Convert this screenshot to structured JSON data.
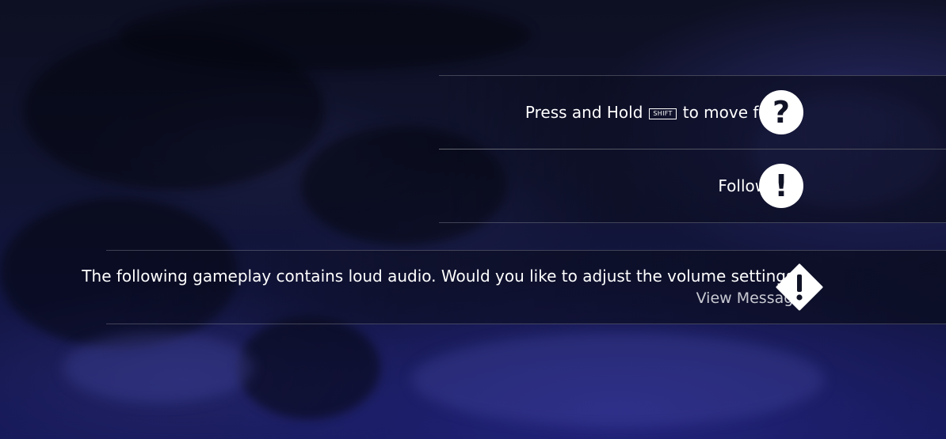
{
  "notifications": [
    {
      "type": "hint",
      "text_before_key": "Press and Hold",
      "key_label": "SHIFT",
      "text_after_key": "to move faster.",
      "icon": "question-mark-icon",
      "icon_glyph": "?"
    },
    {
      "type": "objective",
      "text": "Follow Safi",
      "icon": "exclamation-icon",
      "icon_glyph": "!"
    },
    {
      "type": "warning",
      "text": "The following gameplay contains loud audio. Would you like to adjust the volume settings?",
      "link_text": "View Message",
      "icon": "warning-diamond-icon"
    }
  ],
  "colors": {
    "text": "#ffffff",
    "link_text": "#c8c9d2",
    "icon_fill": "#ffffff",
    "icon_glyph": "#101226",
    "background_tint": "#111430"
  }
}
